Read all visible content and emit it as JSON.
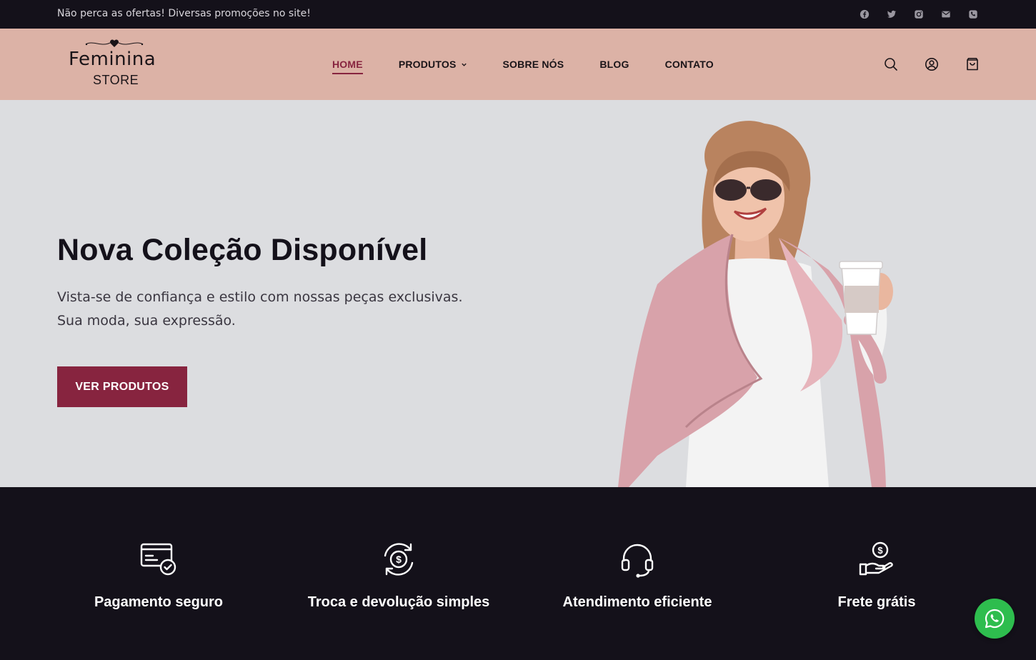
{
  "topbar": {
    "promo": "Não perca as ofertas! Diversas promoções no site!",
    "socials": [
      "facebook-icon",
      "twitter-icon",
      "instagram-icon",
      "mail-icon",
      "phone-icon"
    ]
  },
  "header": {
    "logo": {
      "brand": "Feminina",
      "store": "STORE"
    },
    "nav": [
      {
        "label": "HOME",
        "active": true
      },
      {
        "label": "PRODUTOS",
        "dropdown": true
      },
      {
        "label": "SOBRE NÓS"
      },
      {
        "label": "BLOG"
      },
      {
        "label": "CONTATO"
      }
    ],
    "icons": [
      "search-icon",
      "account-icon",
      "cart-icon"
    ]
  },
  "hero": {
    "title": "Nova Coleção Disponível",
    "subtitle_line1": "Vista-se de confiança e estilo com nossas peças exclusivas.",
    "subtitle_line2": "Sua moda, sua expressão.",
    "cta": "VER PRODUTOS"
  },
  "features": [
    {
      "icon": "secure-payment-icon",
      "label": "Pagamento seguro"
    },
    {
      "icon": "exchange-icon",
      "label": "Troca e devolução simples"
    },
    {
      "icon": "headset-icon",
      "label": "Atendimento eficiente"
    },
    {
      "icon": "free-shipping-icon",
      "label": "Frete grátis"
    }
  ],
  "colors": {
    "dark": "#14111a",
    "header_bg": "#dcb2a6",
    "hero_bg": "#dcdde0",
    "accent": "#87243f",
    "whatsapp": "#2ebd4e"
  }
}
